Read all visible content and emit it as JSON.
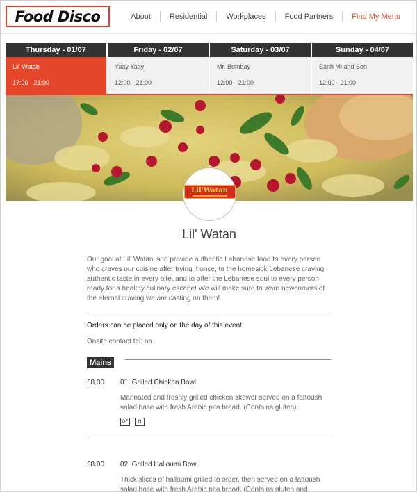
{
  "header": {
    "logo_text": "Food Disco",
    "nav": [
      "About",
      "Residential",
      "Workplaces",
      "Food Partners",
      "Find My Menu"
    ],
    "active_nav": "Find My Menu"
  },
  "schedule": [
    {
      "day": "Thursday - 01/07",
      "vendor": "Lil' Watan",
      "time": "17:00 - 21:00",
      "selected": true
    },
    {
      "day": "Friday - 02/07",
      "vendor": "Yaay Yaay",
      "time": "12:00 - 21:00",
      "selected": false
    },
    {
      "day": "Saturday - 03/07",
      "vendor": "Mr. Bombay",
      "time": "12:00 - 21:00",
      "selected": false
    },
    {
      "day": "Sunday - 04/07",
      "vendor": "Banh Mi and Son",
      "time": "12:00 - 21:00",
      "selected": false
    }
  ],
  "vendor": {
    "logo_text": "Lil'Watan",
    "name": "Lil' Watan",
    "description": "Our goal at Lil' Watan is to provide authentic Lebanese food to every person who craves our cuisine after trying it once, to the homesick Lebanese craving authentic taste in every bite, and to offer the Lebanese soul to every person ready for a healthy culinary escape! We will make sure to warn newcomers of the eternal craving we are casting on them!",
    "orders_note": "Orders can be placed only on the day of this event",
    "contact": "Onsite contact tel: na"
  },
  "menu": {
    "section": "Mains",
    "items": [
      {
        "price": "£8.00",
        "name": "01. Grilled Chicken Bowl",
        "description": "Marinated and freshly grilled chicken skewer served on a fattoush salad base with fresh Arabic pita bread. (Contains gluten).",
        "tags": [
          "DF",
          "H"
        ]
      },
      {
        "price": "£8.00",
        "name": "02. Grilled Halloumi Bowl",
        "description": "Thick slices of halloumi grilled to order, then served on a fattoush salad base with fresh Arabic pita bread. (Contains gluten and",
        "tags": []
      }
    ]
  },
  "colors": {
    "accent": "#e5472b",
    "dark": "#333333",
    "light_bg": "#f1f1f1"
  },
  "icons": {
    "hero": "food-photo",
    "logo": "lil-watan-logo"
  }
}
